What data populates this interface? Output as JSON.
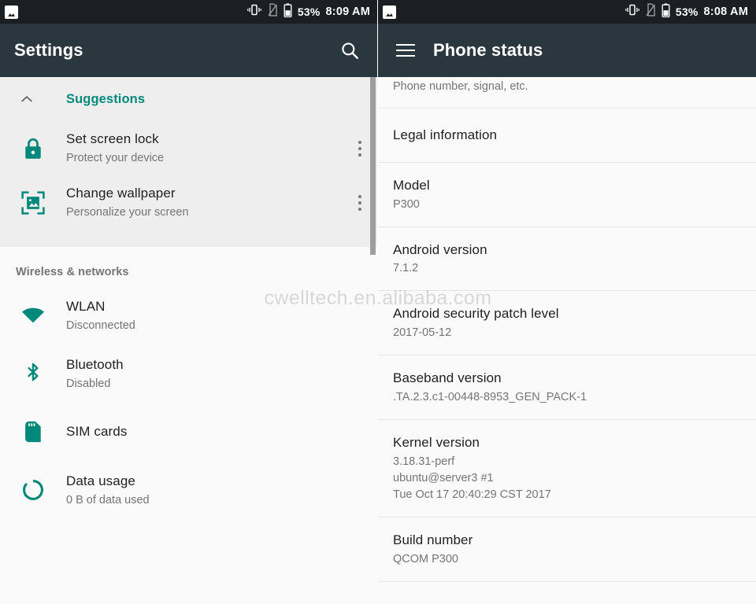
{
  "watermark": "cwelltech.en.alibaba.com",
  "colors": {
    "accent": "#00897b",
    "appbar": "#2b373e",
    "statusbar": "#1b1f23",
    "list_bg": "#fafafa",
    "card_bg": "#eeeeee",
    "title_text": "#212121",
    "sub_text": "#757575"
  },
  "left": {
    "statusbar": {
      "notification_icon": "image-icon",
      "vibrate_icon": "vibrate-icon",
      "sim_icon": "no-sim-icon",
      "battery_icon": "battery-icon",
      "battery_percent": "53%",
      "time": "8:09 AM"
    },
    "appbar": {
      "title": "Settings",
      "search_icon": "search-icon"
    },
    "suggestions": {
      "label": "Suggestions",
      "collapse_icon": "chevron-up-icon",
      "items": [
        {
          "icon": "lock-icon",
          "title": "Set screen lock",
          "subtitle": "Protect your device",
          "overflow": "more-vert-icon"
        },
        {
          "icon": "wallpaper-icon",
          "title": "Change wallpaper",
          "subtitle": "Personalize your screen",
          "overflow": "more-vert-icon"
        }
      ]
    },
    "section_label": "Wireless & networks",
    "items": [
      {
        "icon": "wifi-icon",
        "title": "WLAN",
        "subtitle": "Disconnected"
      },
      {
        "icon": "bluetooth-icon",
        "title": "Bluetooth",
        "subtitle": "Disabled"
      },
      {
        "icon": "sim-card-icon",
        "title": "SIM cards",
        "subtitle": ""
      },
      {
        "icon": "data-usage-icon",
        "title": "Data usage",
        "subtitle": "0 B of data used"
      }
    ]
  },
  "right": {
    "statusbar": {
      "notification_icon": "image-icon",
      "vibrate_icon": "vibrate-icon",
      "sim_icon": "no-sim-icon",
      "battery_icon": "battery-icon",
      "battery_percent": "53%",
      "time": "8:08 AM"
    },
    "appbar": {
      "title": "Phone status",
      "menu_icon": "hamburger-menu-icon"
    },
    "items": [
      {
        "title": "",
        "subtitle": "Phone number, signal, etc."
      },
      {
        "title": "Legal information",
        "subtitle": ""
      },
      {
        "title": "Model",
        "subtitle": "P300"
      },
      {
        "title": "Android version",
        "subtitle": "7.1.2"
      },
      {
        "title": "Android security patch level",
        "subtitle": "2017-05-12"
      },
      {
        "title": "Baseband version",
        "subtitle": ".TA.2.3.c1-00448-8953_GEN_PACK-1"
      },
      {
        "title": "Kernel version",
        "subtitle": "3.18.31-perf\nubuntu@server3 #1\nTue Oct 17 20:40:29 CST 2017"
      },
      {
        "title": "Build number",
        "subtitle": "QCOM  P300"
      }
    ]
  }
}
